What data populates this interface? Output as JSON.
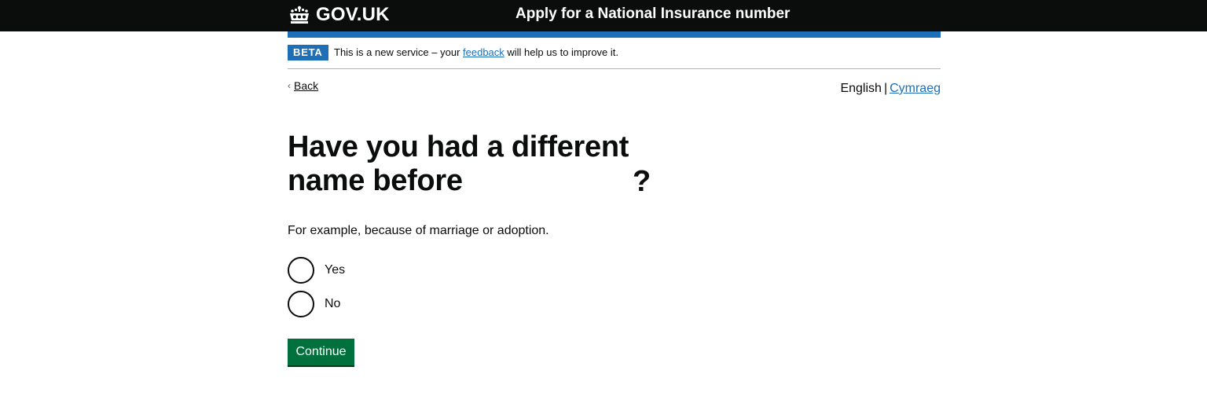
{
  "header": {
    "logo_text": "GOV.UK",
    "service_name": "Apply for a National Insurance number",
    "logo_icon": "crown-icon"
  },
  "phase_banner": {
    "tag": "BETA",
    "text_before": "This is a new service – your ",
    "link_text": "feedback",
    "text_after": " will help us to improve it."
  },
  "back_link": {
    "label": "Back",
    "icon": "chevron-left-icon"
  },
  "language_toggle": {
    "current": "English",
    "separator": "|",
    "other": "Cymraeg"
  },
  "question": {
    "heading": "Have you had a different name before",
    "question_mark": "?",
    "hint": "For example, because of marriage or adoption."
  },
  "radios": [
    {
      "label": "Yes",
      "selected": false
    },
    {
      "label": "No",
      "selected": false
    }
  ],
  "actions": {
    "continue_label": "Continue"
  },
  "colors": {
    "header_bg": "#0b0c0c",
    "brand_blue": "#1d70b8",
    "button_green": "#00703c",
    "text": "#0b0c0c"
  }
}
